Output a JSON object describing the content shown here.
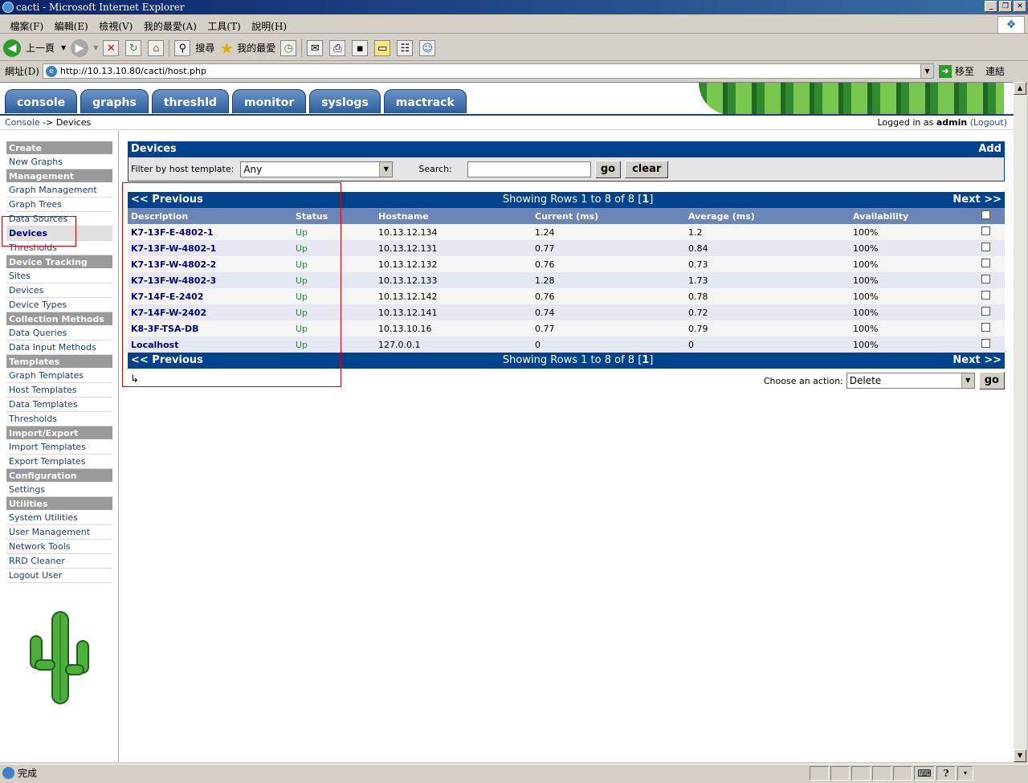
{
  "window": {
    "title": "cacti - Microsoft Internet Explorer"
  },
  "menubar": [
    "檔案(F)",
    "編輯(E)",
    "檢視(V)",
    "我的最愛(A)",
    "工具(T)",
    "說明(H)"
  ],
  "toolbar": {
    "back": "上一頁",
    "search": "搜尋",
    "favorites": "我的最愛"
  },
  "addressbar": {
    "label": "網址(D)",
    "url": "http://10.13.10.80/cacti/host.php",
    "go": "移至",
    "links": "連結"
  },
  "tabs": [
    "console",
    "graphs",
    "threshld",
    "monitor",
    "syslogs",
    "mactrack"
  ],
  "breadcrumb": {
    "console": "Console",
    "sep": "->",
    "current": "Devices"
  },
  "login": {
    "prefix": "Logged in as",
    "user": "admin",
    "logout": "(Logout)"
  },
  "sidebar": [
    {
      "type": "header",
      "label": "Create"
    },
    {
      "type": "item",
      "label": "New Graphs"
    },
    {
      "type": "header",
      "label": "Management"
    },
    {
      "type": "item",
      "label": "Graph Management"
    },
    {
      "type": "item",
      "label": "Graph Trees"
    },
    {
      "type": "item",
      "label": "Data Sources"
    },
    {
      "type": "item",
      "label": "Devices",
      "active": true
    },
    {
      "type": "item",
      "label": "Thresholds"
    },
    {
      "type": "header",
      "label": "Device Tracking"
    },
    {
      "type": "item",
      "label": "Sites"
    },
    {
      "type": "item",
      "label": "Devices"
    },
    {
      "type": "item",
      "label": "Device Types"
    },
    {
      "type": "header",
      "label": "Collection Methods"
    },
    {
      "type": "item",
      "label": "Data Queries"
    },
    {
      "type": "item",
      "label": "Data Input Methods"
    },
    {
      "type": "header",
      "label": "Templates"
    },
    {
      "type": "item",
      "label": "Graph Templates"
    },
    {
      "type": "item",
      "label": "Host Templates"
    },
    {
      "type": "item",
      "label": "Data Templates"
    },
    {
      "type": "item",
      "label": "Thresholds"
    },
    {
      "type": "header",
      "label": "Import/Export"
    },
    {
      "type": "item",
      "label": "Import Templates"
    },
    {
      "type": "item",
      "label": "Export Templates"
    },
    {
      "type": "header",
      "label": "Configuration"
    },
    {
      "type": "item",
      "label": "Settings"
    },
    {
      "type": "header",
      "label": "Utilities"
    },
    {
      "type": "item",
      "label": "System Utilities"
    },
    {
      "type": "item",
      "label": "User Management"
    },
    {
      "type": "item",
      "label": "Network Tools"
    },
    {
      "type": "item",
      "label": "RRD Cleaner"
    },
    {
      "type": "item",
      "label": "Logout User"
    }
  ],
  "devices_panel": {
    "title": "Devices",
    "add": "Add"
  },
  "filter": {
    "label": "Filter by host template:",
    "value": "Any",
    "search_label": "Search:",
    "search_value": "",
    "go": "go",
    "clear": "clear"
  },
  "pager": {
    "prev": "<< Previous",
    "showing": "Showing Rows 1 to 8 of 8 [",
    "page": "1",
    "close": "]",
    "next": "Next >>"
  },
  "columns": [
    "Description",
    "Status",
    "Hostname",
    "Current (ms)",
    "Average (ms)",
    "Availability"
  ],
  "rows": [
    [
      "K7-13F-E-4802-1",
      "Up",
      "10.13.12.134",
      "1.24",
      "1.2",
      "100%"
    ],
    [
      "K7-13F-W-4802-1",
      "Up",
      "10.13.12.131",
      "0.77",
      "0.84",
      "100%"
    ],
    [
      "K7-13F-W-4802-2",
      "Up",
      "10.13.12.132",
      "0.76",
      "0.73",
      "100%"
    ],
    [
      "K7-13F-W-4802-3",
      "Up",
      "10.13.12.133",
      "1.28",
      "1.73",
      "100%"
    ],
    [
      "K7-14F-E-2402",
      "Up",
      "10.13.12.142",
      "0.76",
      "0.78",
      "100%"
    ],
    [
      "K7-14F-W-2402",
      "Up",
      "10.13.12.141",
      "0.74",
      "0.72",
      "100%"
    ],
    [
      "K8-3F-TSA-DB",
      "Up",
      "10.13.10.16",
      "0.77",
      "0.79",
      "100%"
    ],
    [
      "Localhost",
      "Up",
      "127.0.0.1",
      "0",
      "0",
      "100%"
    ]
  ],
  "action": {
    "label": "Choose an action:",
    "value": "Delete",
    "go": "go"
  },
  "statusbar": {
    "text": "完成"
  }
}
